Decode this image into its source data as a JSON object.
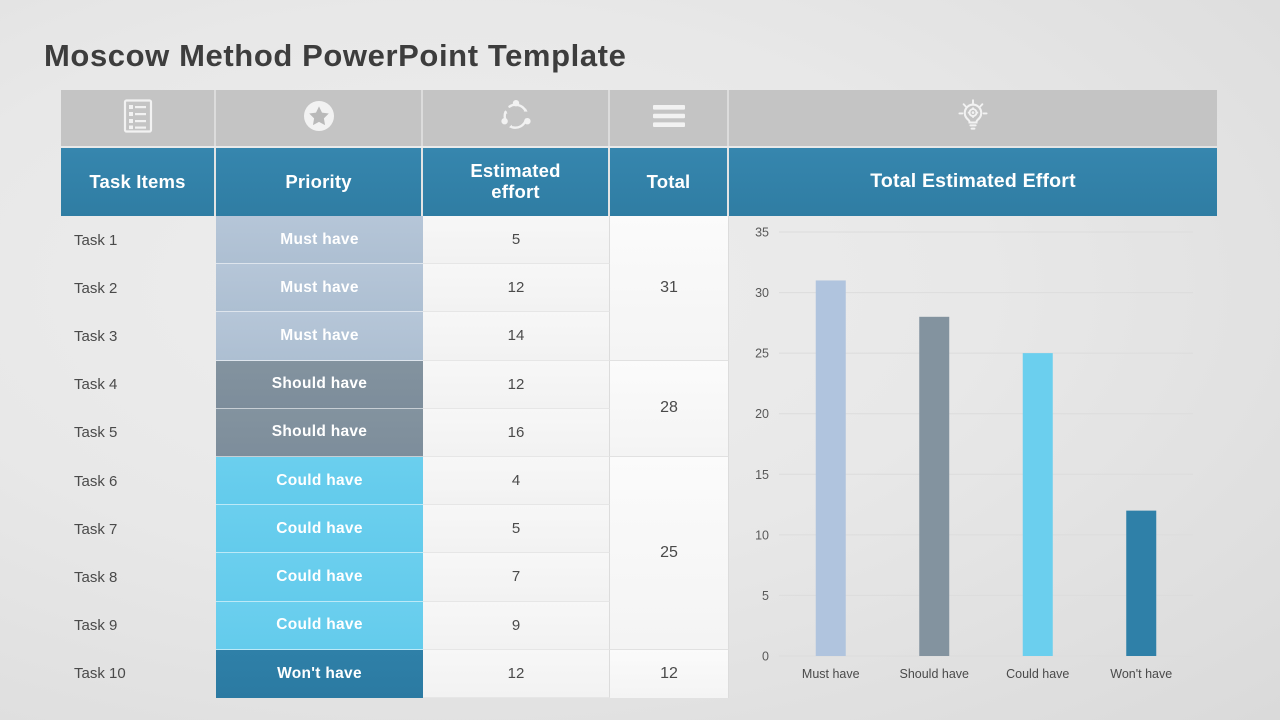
{
  "page_title": "Moscow Method PowerPoint Template",
  "icons": {
    "task_items": "checklist-icon",
    "priority": "star-circle-icon",
    "estimated_effort": "cycle-arrows-icon",
    "total": "hamburger-lines-icon",
    "chart": "lightbulb-gear-icon"
  },
  "table": {
    "headers": {
      "task_items": "Task Items",
      "priority": "Priority",
      "estimated_effort": "Estimated effort",
      "estimated_effort_line1": "Estimated",
      "estimated_effort_line2": "effort",
      "total": "Total",
      "chart": "Total Estimated Effort"
    },
    "rows": [
      {
        "task": "Task 1",
        "priority": "Must have",
        "effort": "5"
      },
      {
        "task": "Task 2",
        "priority": "Must have",
        "effort": "12"
      },
      {
        "task": "Task 3",
        "priority": "Must have",
        "effort": "14"
      },
      {
        "task": "Task 4",
        "priority": "Should have",
        "effort": "12"
      },
      {
        "task": "Task 5",
        "priority": "Should have",
        "effort": "16"
      },
      {
        "task": "Task 6",
        "priority": "Could have",
        "effort": "4"
      },
      {
        "task": "Task 7",
        "priority": "Could have",
        "effort": "5"
      },
      {
        "task": "Task 8",
        "priority": "Could have",
        "effort": "7"
      },
      {
        "task": "Task 9",
        "priority": "Could have",
        "effort": "9"
      },
      {
        "task": "Task 10",
        "priority": "Won't have",
        "effort": "12"
      }
    ],
    "totals": [
      {
        "value": "31",
        "span": 3
      },
      {
        "value": "28",
        "span": 2
      },
      {
        "value": "25",
        "span": 4
      },
      {
        "value": "12",
        "span": 1
      }
    ]
  },
  "colors": {
    "header_blue": "#3180a8",
    "icon_bar_gray": "#c4c4c4",
    "must_have": "#b0c4de",
    "should_have": "#83939f",
    "could_have": "#6bcfee",
    "wont_have": "#2f80a8",
    "background": "#e5e5e5",
    "title_text": "#3d3d3d"
  },
  "chart_data": {
    "type": "bar",
    "title": "Total Estimated Effort",
    "categories": [
      "Must have",
      "Should have",
      "Could have",
      "Won't have"
    ],
    "values": [
      31,
      28,
      25,
      12
    ],
    "colors": [
      "#b0c4de",
      "#83939f",
      "#6bcfee",
      "#2f80a8"
    ],
    "xlabel": "",
    "ylabel": "",
    "ylim": [
      0,
      35
    ],
    "yticks": [
      0,
      5,
      10,
      15,
      20,
      25,
      30,
      35
    ],
    "ytick_labels": [
      "0",
      "5",
      "10",
      "15",
      "20",
      "25",
      "30",
      "35"
    ],
    "grid": true,
    "legend": false
  }
}
